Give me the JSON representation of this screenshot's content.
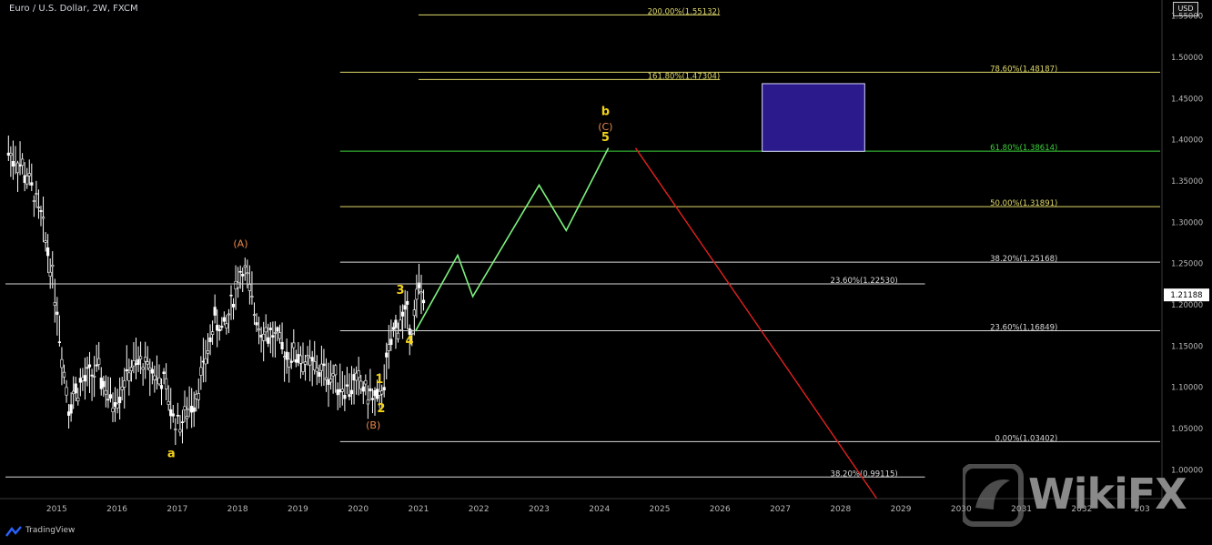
{
  "header": {
    "title": "Euro / U.S. Dollar, 2W, FXCM",
    "currency": "USD"
  },
  "footer": {
    "brand": "TradingView"
  },
  "watermark": {
    "text": "WikiFX"
  },
  "colors": {
    "background": "#000000",
    "candles": "#ffffff",
    "fib_yellow": "#e0d96a",
    "fib_green": "#3bd13b",
    "fib_white": "#d8d8d8",
    "projection_green": "#7df27d",
    "projection_red": "#e02020",
    "target_box": "#2a1a8c",
    "wave_label_yellow": "#f2d21b",
    "wave_label_orange": "#e8884a"
  },
  "chart_data": {
    "type": "candlestick",
    "symbol": "Euro / U.S. Dollar",
    "timeframe": "2W",
    "source": "FXCM",
    "xlim": [
      2014.15,
      2033.3
    ],
    "ylim": [
      0.965,
      1.565
    ],
    "x_tick_labels": [
      "2015",
      "2016",
      "2017",
      "2018",
      "2019",
      "2020",
      "2021",
      "2022",
      "2023",
      "2024",
      "2025",
      "2026",
      "2027",
      "2028",
      "2029",
      "2030",
      "2031",
      "2032",
      "203"
    ],
    "x_tick_values": [
      2015,
      2016,
      2017,
      2018,
      2019,
      2020,
      2021,
      2022,
      2023,
      2024,
      2025,
      2026,
      2027,
      2028,
      2029,
      2030,
      2031,
      2032,
      2033
    ],
    "y_tick_labels": [
      "1.55000",
      "1.50000",
      "1.45000",
      "1.40000",
      "1.35000",
      "1.30000",
      "1.25000",
      "1.20000",
      "1.15000",
      "1.10000",
      "1.05000",
      "1.00000"
    ],
    "y_tick_values": [
      1.55,
      1.5,
      1.45,
      1.4,
      1.35,
      1.3,
      1.25,
      1.2,
      1.15,
      1.1,
      1.05,
      1.0
    ],
    "current_price": {
      "label": "1.21188",
      "value": 1.21188
    },
    "price_path": [
      [
        2014.2,
        1.385
      ],
      [
        2014.4,
        1.37
      ],
      [
        2014.6,
        1.34
      ],
      [
        2014.75,
        1.3
      ],
      [
        2014.9,
        1.25
      ],
      [
        2015.0,
        1.2
      ],
      [
        2015.1,
        1.13
      ],
      [
        2015.2,
        1.08
      ],
      [
        2015.35,
        1.1
      ],
      [
        2015.5,
        1.11
      ],
      [
        2015.7,
        1.12
      ],
      [
        2015.9,
        1.08
      ],
      [
        2016.0,
        1.09
      ],
      [
        2016.2,
        1.12
      ],
      [
        2016.4,
        1.13
      ],
      [
        2016.6,
        1.12
      ],
      [
        2016.8,
        1.1
      ],
      [
        2016.95,
        1.06
      ],
      [
        2017.1,
        1.06
      ],
      [
        2017.3,
        1.09
      ],
      [
        2017.5,
        1.14
      ],
      [
        2017.6,
        1.18
      ],
      [
        2017.8,
        1.17
      ],
      [
        2018.0,
        1.23
      ],
      [
        2018.1,
        1.245
      ],
      [
        2018.25,
        1.2
      ],
      [
        2018.4,
        1.17
      ],
      [
        2018.6,
        1.16
      ],
      [
        2018.8,
        1.14
      ],
      [
        2019.0,
        1.14
      ],
      [
        2019.2,
        1.125
      ],
      [
        2019.4,
        1.12
      ],
      [
        2019.6,
        1.11
      ],
      [
        2019.8,
        1.1
      ],
      [
        2020.0,
        1.105
      ],
      [
        2020.2,
        1.09
      ],
      [
        2020.35,
        1.08
      ],
      [
        2020.45,
        1.12
      ],
      [
        2020.6,
        1.17
      ],
      [
        2020.7,
        1.18
      ],
      [
        2020.8,
        1.19
      ],
      [
        2020.9,
        1.17
      ],
      [
        2021.0,
        1.22
      ],
      [
        2021.1,
        1.21
      ]
    ],
    "fib_levels": [
      {
        "label": "200.00%(1.55132)",
        "value": 1.55132,
        "color": "#e0d96a"
      },
      {
        "label": "78.60%(1.48187)",
        "value": 1.48187,
        "color": "#e0d96a"
      },
      {
        "label": "161.80%(1.47304)",
        "value": 1.47304,
        "color": "#e0d96a"
      },
      {
        "label": "61.80%(1.38614)",
        "value": 1.38614,
        "color": "#3bd13b"
      },
      {
        "label": "50.00%(1.31891)",
        "value": 1.31891,
        "color": "#e0d96a"
      },
      {
        "label": "38.20%(1.25168)",
        "value": 1.25168,
        "color": "#d8d8d8"
      },
      {
        "label": "23.60%(1.22530)",
        "value": 1.2253,
        "color": "#d8d8d8"
      },
      {
        "label": "23.60%(1.16849)",
        "value": 1.16849,
        "color": "#d8d8d8"
      },
      {
        "label": "0.00%(1.03402)",
        "value": 1.03402,
        "color": "#d8d8d8"
      },
      {
        "label": "38.20%(0.99115)",
        "value": 0.99115,
        "color": "#d8d8d8"
      }
    ],
    "target_box": {
      "x": [
        2026.7,
        2028.4
      ],
      "y": [
        1.386,
        1.468
      ]
    },
    "projection_green": [
      [
        2020.95,
        1.168
      ],
      [
        2021.65,
        1.26
      ],
      [
        2021.9,
        1.21
      ],
      [
        2023.0,
        1.345
      ],
      [
        2023.45,
        1.29
      ],
      [
        2024.15,
        1.39
      ]
    ],
    "projection_red": [
      [
        2024.6,
        1.39
      ],
      [
        2028.6,
        0.965
      ]
    ],
    "wave_labels": [
      {
        "text": "a",
        "x": 2016.9,
        "y": 1.015,
        "color": "#f2d21b"
      },
      {
        "text": "(A)",
        "x": 2018.05,
        "y": 1.27,
        "color": "#e8884a"
      },
      {
        "text": "(B)",
        "x": 2020.25,
        "y": 1.05,
        "color": "#e8884a"
      },
      {
        "text": "1",
        "x": 2020.35,
        "y": 1.105,
        "color": "#f2d21b"
      },
      {
        "text": "2",
        "x": 2020.38,
        "y": 1.07,
        "color": "#f2d21b"
      },
      {
        "text": "3",
        "x": 2020.7,
        "y": 1.213,
        "color": "#f2d21b"
      },
      {
        "text": "4",
        "x": 2020.85,
        "y": 1.152,
        "color": "#f2d21b"
      },
      {
        "text": "b",
        "x": 2024.1,
        "y": 1.43,
        "color": "#f2d21b"
      },
      {
        "text": "(C)",
        "x": 2024.1,
        "y": 1.4115,
        "color": "#e8884a"
      },
      {
        "text": "5",
        "x": 2024.1,
        "y": 1.3985,
        "color": "#f2d21b"
      }
    ]
  }
}
